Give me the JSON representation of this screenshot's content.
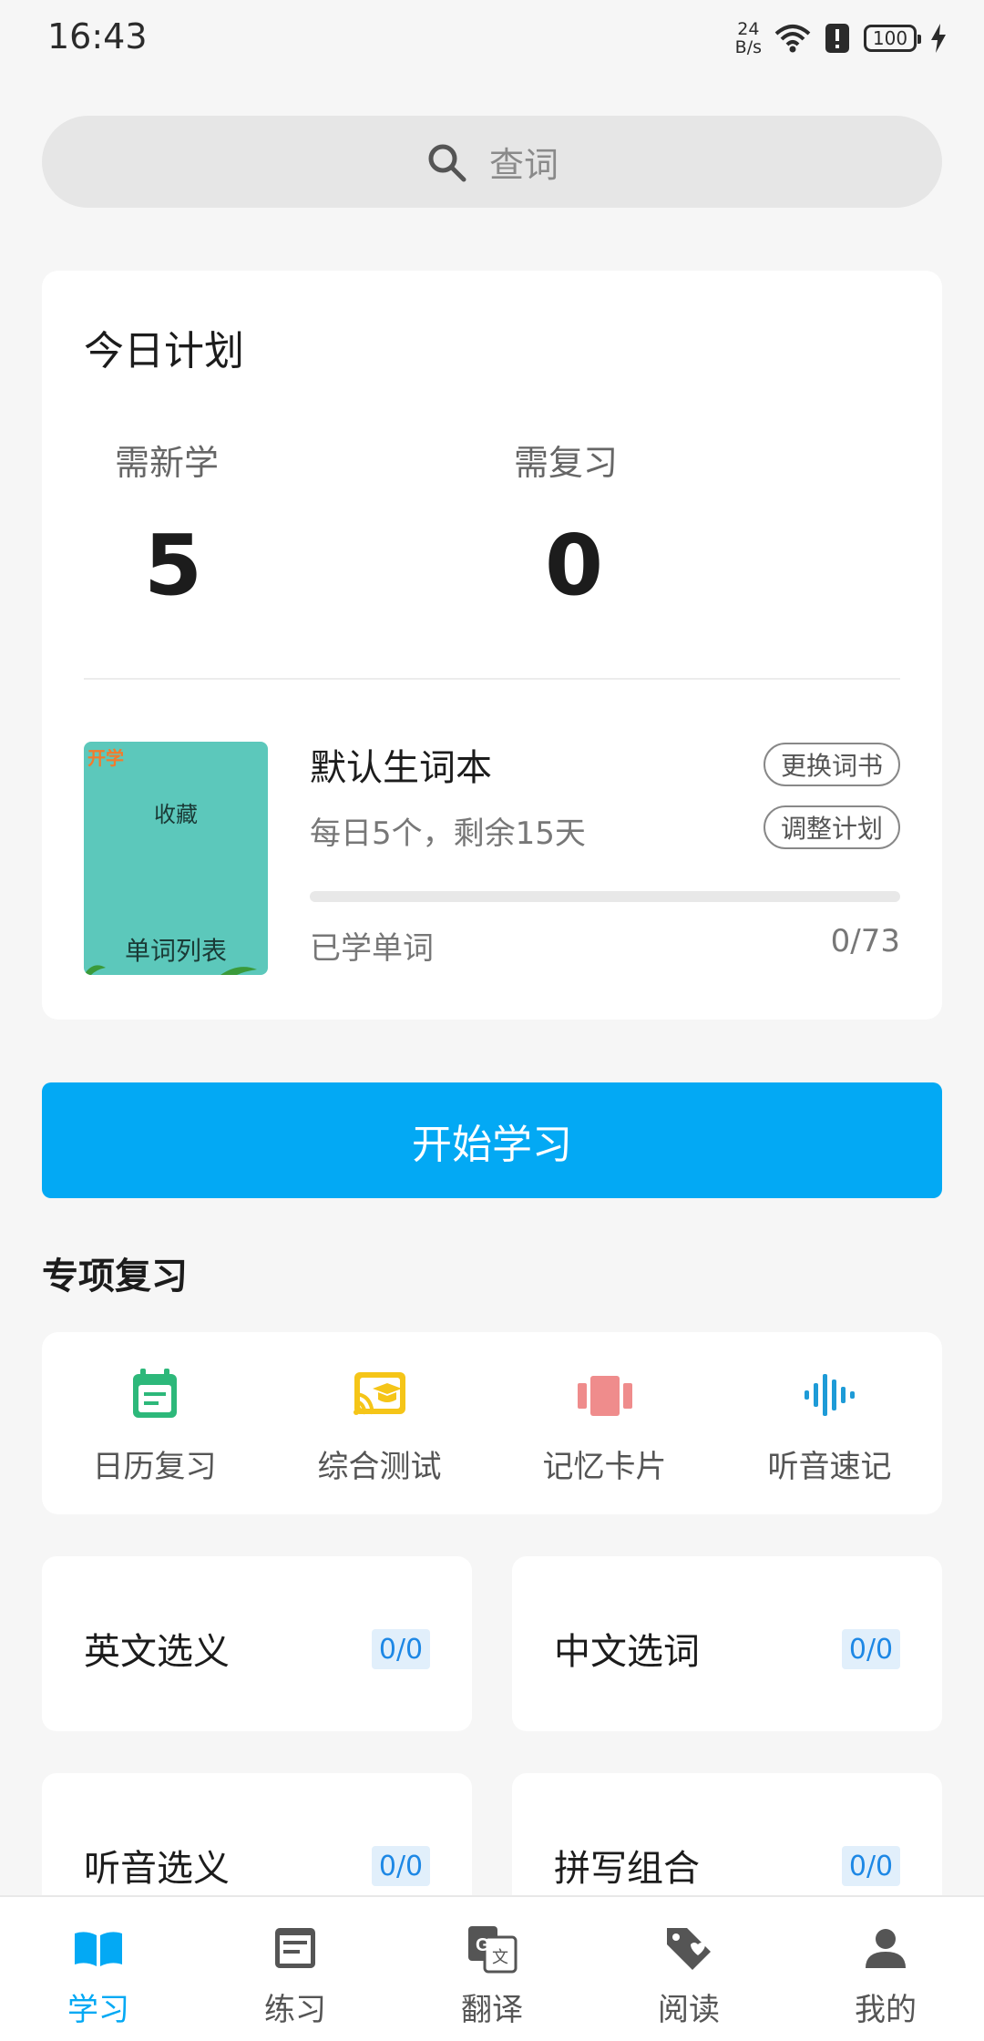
{
  "status_bar": {
    "time": "16:43",
    "net_speed_value": "24",
    "net_speed_unit": "B/s",
    "battery": "100"
  },
  "search": {
    "placeholder": "查词",
    "icon": "search-icon"
  },
  "plan": {
    "title": "今日计划",
    "new_label": "需新学",
    "new_value": "5",
    "review_label": "需复习",
    "review_value": "0",
    "book": {
      "cover_corner": "开学",
      "cover_title": "收藏",
      "cover_list": "单词列表",
      "name": "默认生词本",
      "daily": "每日5个，剩余15天",
      "change_label": "更换词书",
      "adjust_label": "调整计划",
      "learned_label": "已学单词",
      "learned_count": "0/73",
      "progress": 0
    }
  },
  "start_button": "开始学习",
  "special_review": {
    "title": "专项复习",
    "items": [
      {
        "label": "日历复习",
        "icon": "calendar-icon",
        "color": "#2db87a"
      },
      {
        "label": "综合测试",
        "icon": "cast-test-icon",
        "color": "#f5c518"
      },
      {
        "label": "记忆卡片",
        "icon": "cards-icon",
        "color": "#ef8c8c"
      },
      {
        "label": "听音速记",
        "icon": "waveform-icon",
        "color": "#1e9bd7"
      }
    ]
  },
  "quiz_tiles": [
    {
      "label": "英文选义",
      "count": "0/0"
    },
    {
      "label": "中文选词",
      "count": "0/0"
    },
    {
      "label": "听音选义",
      "count": "0/0"
    },
    {
      "label": "拼写组合",
      "count": "0/0"
    }
  ],
  "bottom_nav": [
    {
      "label": "学习",
      "icon": "book-icon",
      "active": true
    },
    {
      "label": "练习",
      "icon": "document-icon",
      "active": false
    },
    {
      "label": "翻译",
      "icon": "translate-icon",
      "active": false
    },
    {
      "label": "阅读",
      "icon": "tag-heart-icon",
      "active": false
    },
    {
      "label": "我的",
      "icon": "user-icon",
      "active": false
    }
  ],
  "colors": {
    "accent": "#03a9f4",
    "background": "#f6f6f6",
    "badge_bg": "#e1effb",
    "badge_text": "#1e88e5"
  }
}
